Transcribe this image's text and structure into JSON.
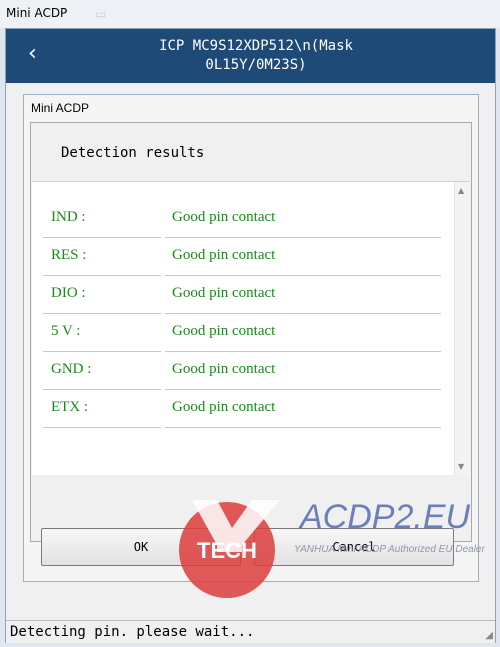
{
  "window": {
    "title": "Mini ACDP"
  },
  "header": {
    "back_icon": "chevron-left-icon",
    "title": "ICP  MC9S12XDP512\\n(Mask\n0L15Y/0M23S)"
  },
  "dialog": {
    "title": "Mini ACDP",
    "heading": "Detection results",
    "rows": [
      {
        "label": "IND :",
        "value": "Good pin contact"
      },
      {
        "label": "RES :",
        "value": "Good pin contact"
      },
      {
        "label": "DIO :",
        "value": "Good pin contact"
      },
      {
        "label": "5 V :",
        "value": "Good pin contact"
      },
      {
        "label": "GND :",
        "value": "Good pin contact"
      },
      {
        "label": "ETX :",
        "value": "Good pin contact"
      }
    ],
    "ok_label": "OK",
    "cancel_label": "Cancel"
  },
  "status": {
    "text": "Detecting pin. please wait..."
  },
  "watermark": {
    "logo_text": "TECH",
    "brand": "ACDP2.EU",
    "subtitle": "YANHUA Mini ACDP Authorized EU Dealer"
  },
  "colors": {
    "header_bg": "#1e4a78",
    "result_green": "#1a8a1a"
  }
}
